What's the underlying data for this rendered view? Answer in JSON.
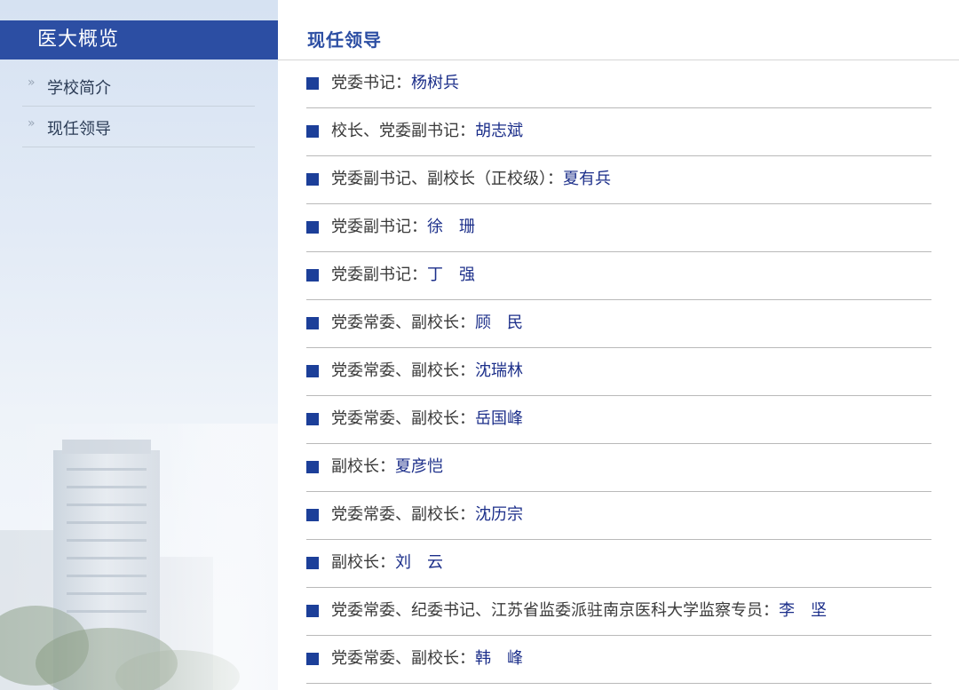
{
  "sidebar": {
    "title": "医大概览",
    "items": [
      {
        "label": "学校简介"
      },
      {
        "label": "现任领导"
      }
    ]
  },
  "main": {
    "title": "现任领导",
    "leaders": [
      {
        "role": "党委书记：",
        "name": "杨树兵"
      },
      {
        "role": "校长、党委副书记：",
        "name": "胡志斌"
      },
      {
        "role": "党委副书记、副校长（正校级）：",
        "name": "夏有兵"
      },
      {
        "role": "党委副书记：",
        "name": "徐　珊"
      },
      {
        "role": "党委副书记：",
        "name": "丁　强"
      },
      {
        "role": "党委常委、副校长：",
        "name": "顾　民"
      },
      {
        "role": "党委常委、副校长：",
        "name": "沈瑞林"
      },
      {
        "role": "党委常委、副校长：",
        "name": "岳国峰"
      },
      {
        "role": "副校长：",
        "name": "夏彦恺"
      },
      {
        "role": "党委常委、副校长：",
        "name": "沈历宗"
      },
      {
        "role": "副校长：",
        "name": "刘　云"
      },
      {
        "role": "党委常委、纪委书记、江苏省监委派驻南京医科大学监察专员：",
        "name": "李　坚"
      },
      {
        "role": "党委常委、副校长：",
        "name": "韩　峰"
      }
    ]
  },
  "colors": {
    "accent": "#2c4ea3",
    "name_link": "#1c2f8a",
    "bullet": "#1c3f99"
  }
}
